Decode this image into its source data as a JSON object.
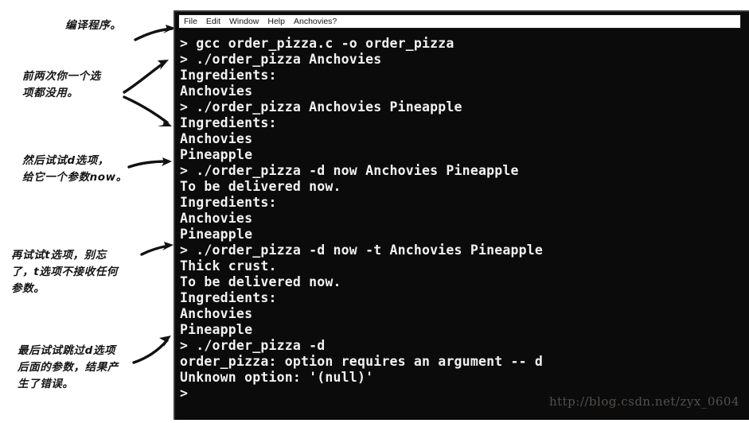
{
  "annotations": [
    {
      "id": "note-compile",
      "text": "编译程序。",
      "arrow": "arrow-right"
    },
    {
      "id": "note-no-options",
      "text": "前两次你一个选\n项都没用。",
      "arrow": "arrow-branch-two"
    },
    {
      "id": "note-d-option",
      "text": "然后试试d选项，\n给它一个参数now。",
      "arrow": "arrow-right"
    },
    {
      "id": "note-t-option",
      "text": "再试试t选项，别忘\n了，t选项不接收任何\n参数。",
      "arrow": "arrow-right"
    },
    {
      "id": "note-missing-arg",
      "text": "最后试试跳过d选项\n后面的参数，结果产\n生了错误。",
      "arrow": "arrow-curve-up-right"
    }
  ],
  "terminal": {
    "menubar": [
      "File",
      "Edit",
      "Window",
      "Help",
      "Anchovies?"
    ],
    "lines": [
      "> gcc order_pizza.c -o order_pizza",
      "> ./order_pizza Anchovies",
      "Ingredients:",
      "Anchovies",
      "> ./order_pizza Anchovies Pineapple",
      "Ingredients:",
      "Anchovies",
      "Pineapple",
      "> ./order_pizza -d now Anchovies Pineapple",
      "To be delivered now.",
      "Ingredients:",
      "Anchovies",
      "Pineapple",
      "> ./order_pizza -d now -t Anchovies Pineapple",
      "Thick crust.",
      "To be delivered now.",
      "Ingredients:",
      "Anchovies",
      "Pineapple",
      "> ./order_pizza -d",
      "order_pizza: option requires an argument -- d",
      "Unknown option: '(null)'",
      ">"
    ],
    "watermark": "http://blog.csdn.net/zyx_0604"
  },
  "colors": {
    "terminal_background": "#0b0b0b",
    "terminal_text": "#f2f2f2",
    "menubar_background": "#ffffff",
    "menubar_text": "#161616",
    "page_background": "#ffffff",
    "annotation_ink": "#141414",
    "watermark_text": "#54514f"
  }
}
